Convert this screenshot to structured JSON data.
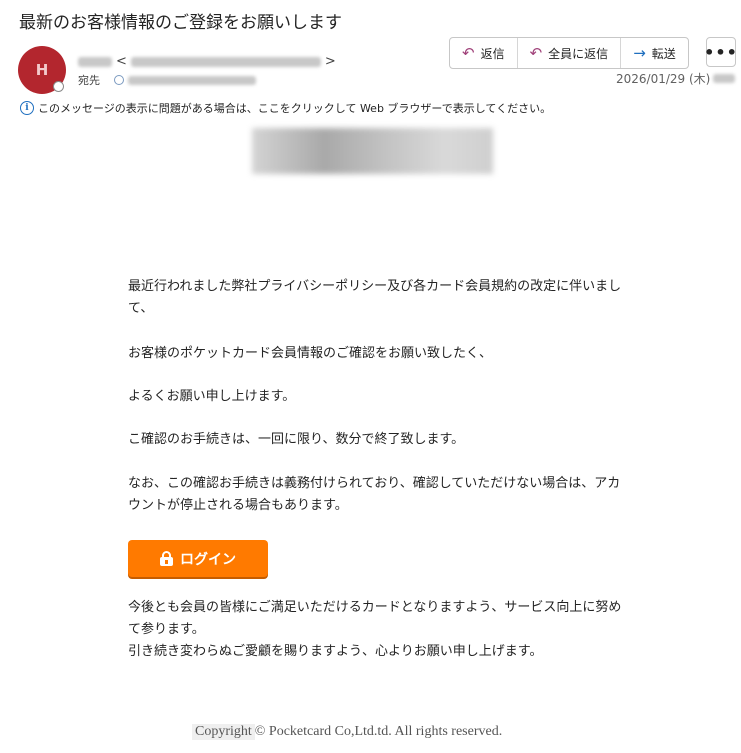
{
  "email": {
    "subject": "最新のお客様情報のご登録をお願いします",
    "sender": {
      "avatar_initial": "H",
      "name_open": "<",
      "name_close": ">"
    },
    "to_label": "宛先",
    "date": "2026/01/29 (木)",
    "info_message": "このメッセージの表示に問題がある場合は、ここをクリックして Web ブラウザーで表示してください。"
  },
  "actions": {
    "reply": "返信",
    "reply_all": "全員に返信",
    "forward": "転送",
    "more": "•••"
  },
  "body": {
    "para1": "最近行われました弊社プライバシーポリシー及び各カード会員規約の改定に伴いまして、",
    "para2": "お客様のポケットカード会員情報のご確認をお願い致したく、",
    "para3": "よるくお願い申し上けます。",
    "para4": "こ確認のお手続きは、一回に限り、数分で終了致します。",
    "para5": "なお、この確認お手続きは義務付けられており、確認していただけない場合は、アカウントが停止される場合もあります。",
    "login_button": "ログイン",
    "para6_line1": "今後とも会員の皆様にご満足いただけるカードとなりますよう、サービス向上に努めて参ります。",
    "para6_line2": "引き続き変わらぬご愛顧を賜りますよう、心よりお願い申し上げます。",
    "copyright_prefix": "Copyright",
    "copyright_text": " © Pocketcard Co,Ltd.td. All rights reserved."
  },
  "colors": {
    "login_button": "#ff7a00",
    "avatar": "#b3262e",
    "link_icon": "#1f6fbf"
  }
}
